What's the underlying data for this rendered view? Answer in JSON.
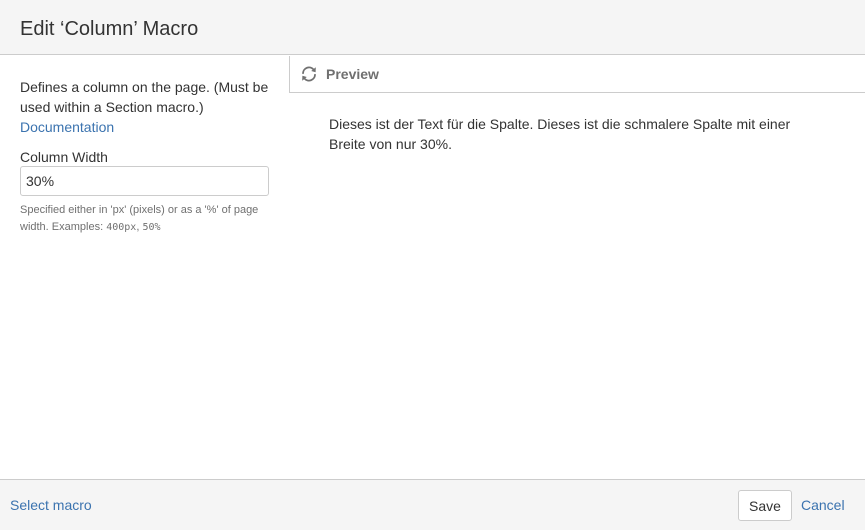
{
  "dialog": {
    "title": "Edit ‘Column’ Macro"
  },
  "macro": {
    "description": "Defines a column on the page. (Must be used within a Section macro.)",
    "documentation_link": "Documentation",
    "field": {
      "label": "Column Width",
      "value": "30%",
      "help_text": "Specified either in 'px' (pixels) or as a '%' of page width. Examples: ",
      "help_example_1": "400px",
      "help_separator": ", ",
      "help_example_2": "50%"
    }
  },
  "preview": {
    "icon": "refresh-icon",
    "label": "Preview",
    "content": "Dieses ist der Text für die Spalte. Dieses ist die schmalere Spalte mit einer Breite von nur 30%."
  },
  "footer": {
    "select_macro_label": "Select macro",
    "save_label": "Save",
    "cancel_label": "Cancel"
  },
  "colors": {
    "link": "#3b73af",
    "header_bg": "#f5f5f5",
    "border": "#cccccc",
    "muted_text": "#707070"
  }
}
